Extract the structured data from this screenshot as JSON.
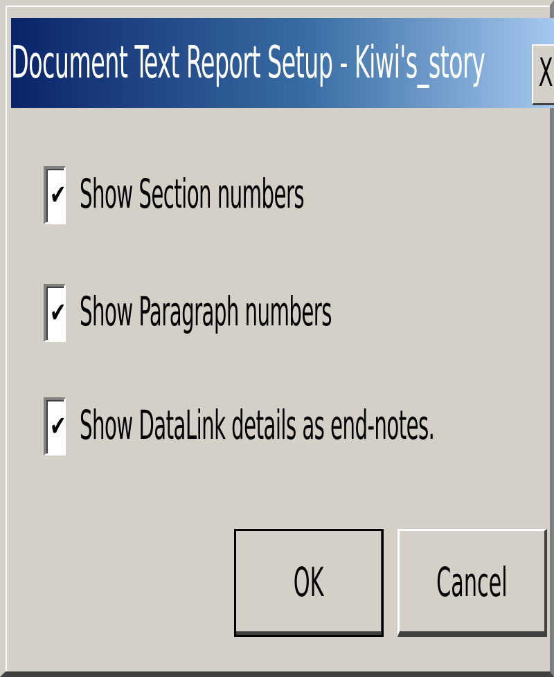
{
  "dialog": {
    "title": "Document Text Report Setup - Kiwi's_story",
    "close_label": "X"
  },
  "options": [
    {
      "label": "Show Section numbers",
      "checked": true
    },
    {
      "label": "Show Paragraph numbers",
      "checked": true
    },
    {
      "label": "Show DataLink details as end-notes.",
      "checked": true
    }
  ],
  "buttons": {
    "ok_label": "OK",
    "cancel_label": "Cancel"
  },
  "icons": {
    "checkmark": "check-icon"
  },
  "colors": {
    "title_gradient_start": "#0a246a",
    "title_gradient_end": "#a6caf0",
    "face": "#d4d0c8"
  }
}
